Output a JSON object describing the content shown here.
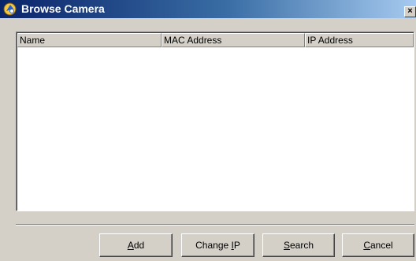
{
  "window": {
    "title": "Browse Camera",
    "close_label": "×",
    "app_icon": "browse-camera-app-icon"
  },
  "list": {
    "columns": [
      {
        "label": "Name"
      },
      {
        "label": "MAC Address"
      },
      {
        "label": "IP Address"
      }
    ],
    "rows": []
  },
  "buttons": {
    "add": {
      "prefix": "",
      "accel": "A",
      "suffix": "dd"
    },
    "change_ip": {
      "prefix": "Change ",
      "accel": "I",
      "suffix": "P"
    },
    "search": {
      "prefix": "",
      "accel": "S",
      "suffix": "earch"
    },
    "cancel": {
      "prefix": "",
      "accel": "C",
      "suffix": "ancel"
    }
  },
  "colors": {
    "titlebar_start": "#0a246a",
    "titlebar_end": "#a6caf0",
    "face": "#d4d0c8",
    "list_background": "#ffffff"
  }
}
